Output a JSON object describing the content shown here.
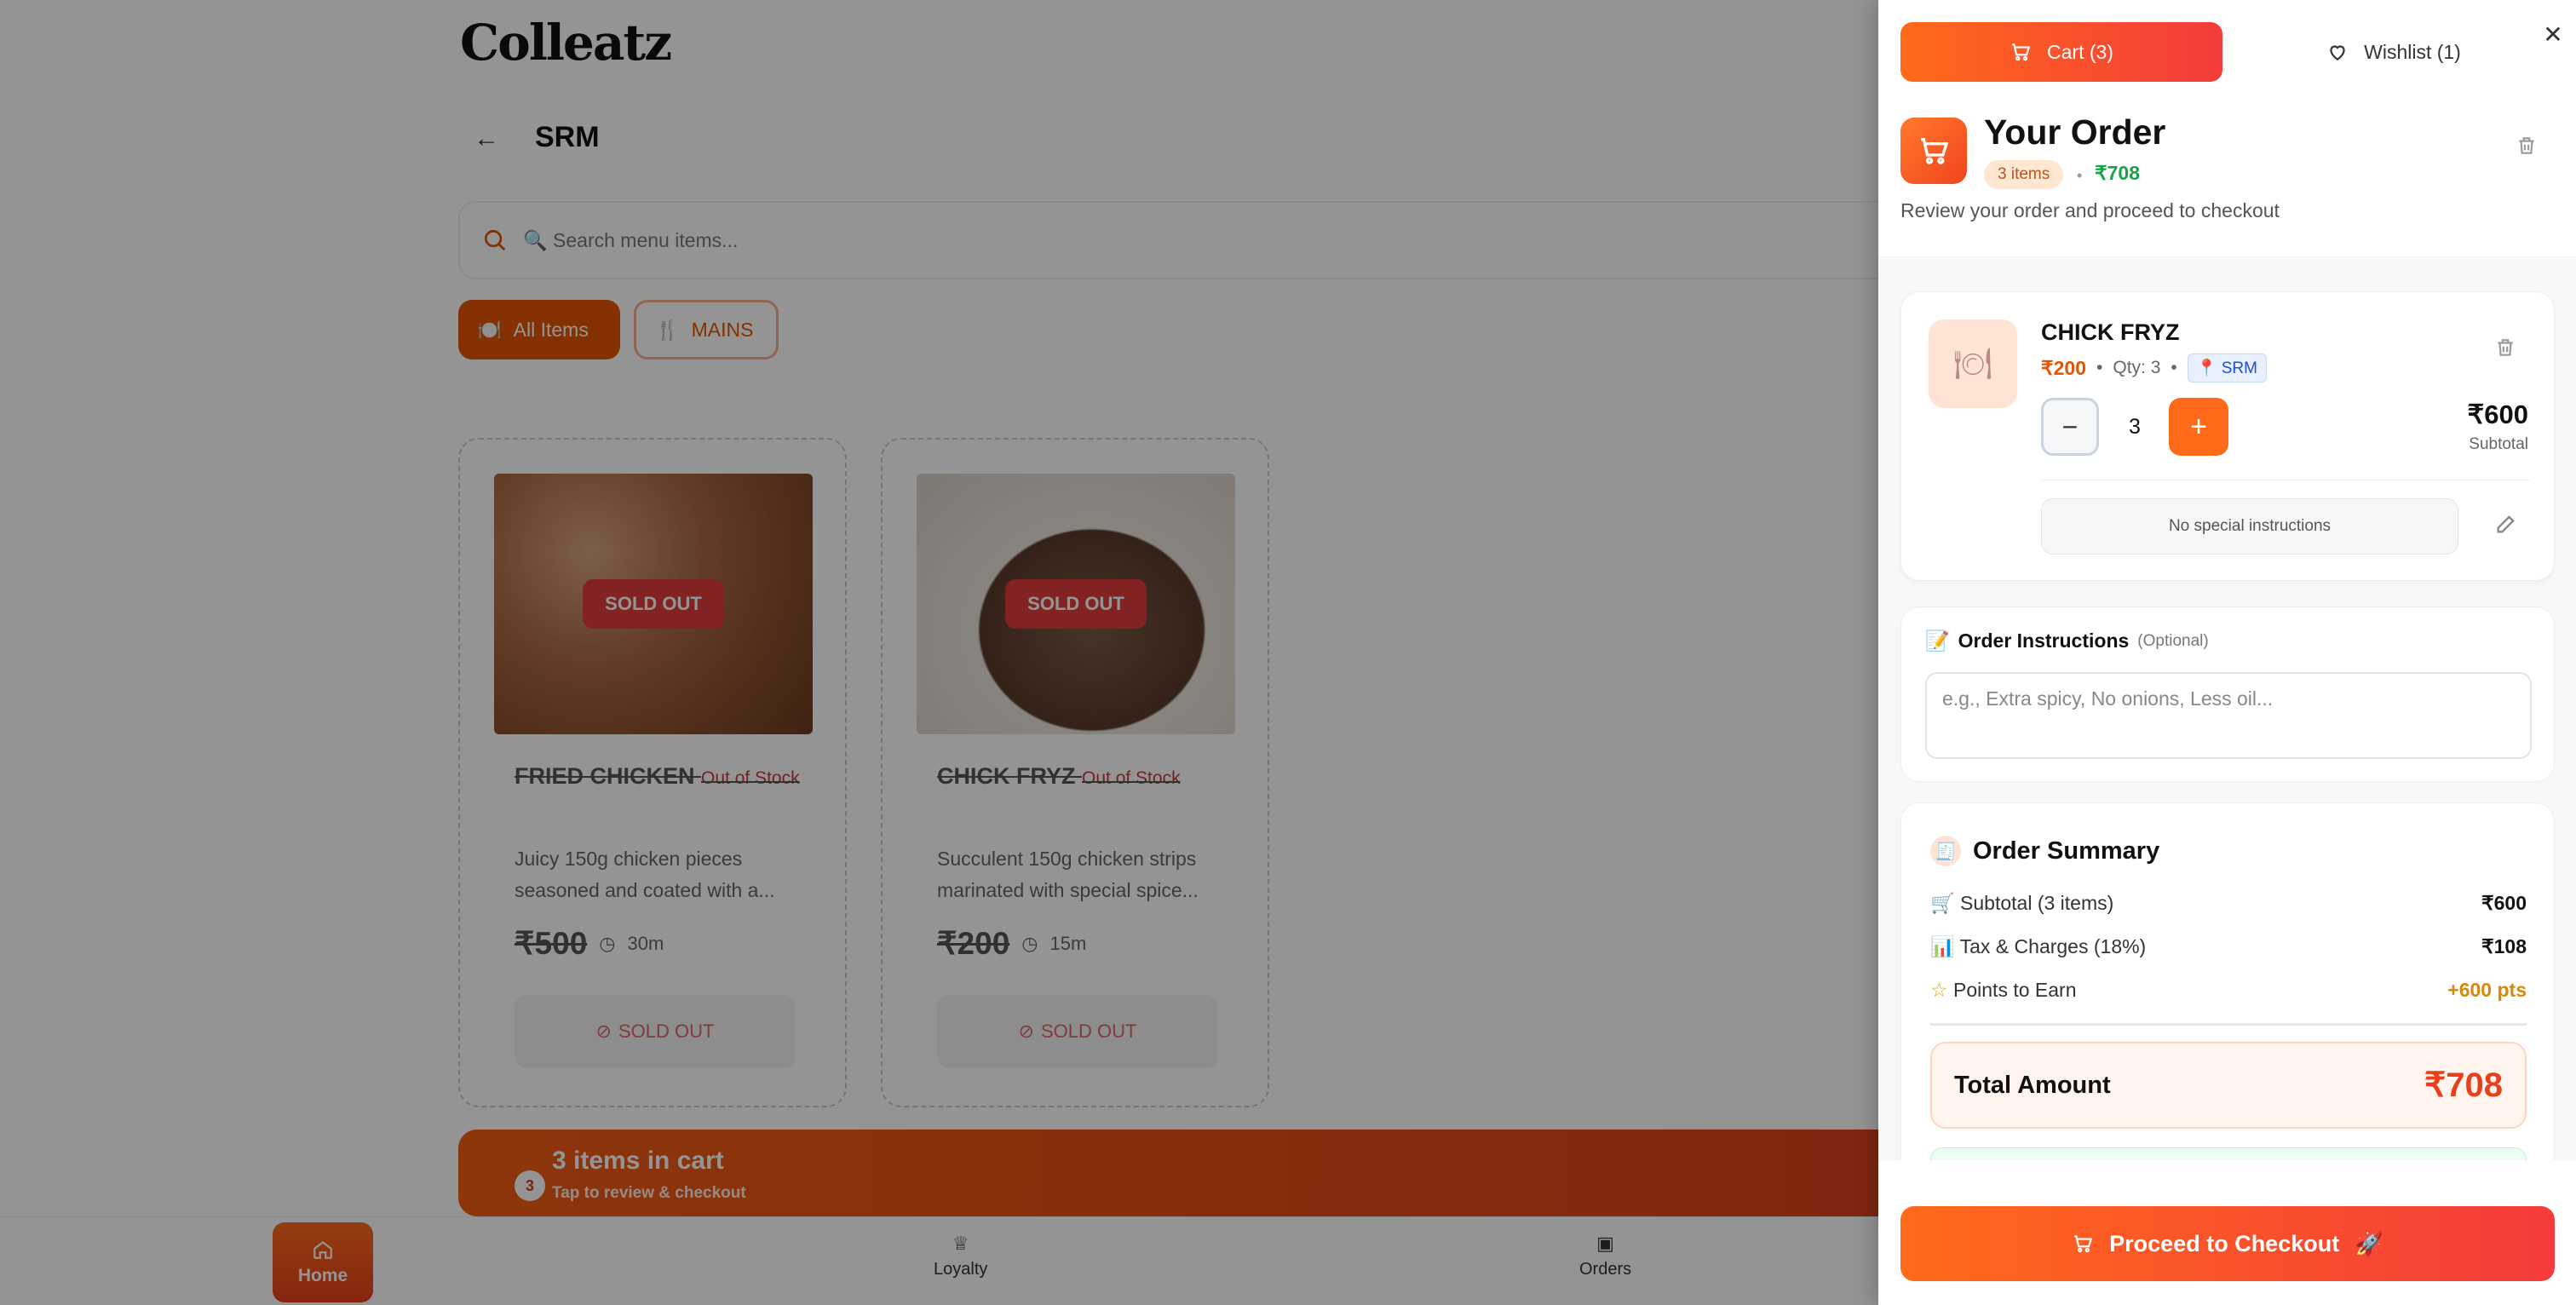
{
  "app": {
    "brand": "Colleatz"
  },
  "header": {
    "location": "SRM"
  },
  "search": {
    "placeholder": "🔍 Search menu items..."
  },
  "filters": [
    {
      "label": "All Items",
      "active": true
    },
    {
      "label": "MAINS",
      "active": false
    }
  ],
  "menu_items": [
    {
      "name": "FRIED CHICKEN",
      "stock": "Out of Stock",
      "badge": "SOLD OUT",
      "description": "Juicy 150g chicken pieces seasoned and coated with a...",
      "price": "₹500",
      "time": "30m",
      "button": "SOLD OUT"
    },
    {
      "name": "CHICK FRYZ",
      "stock": "Out of Stock",
      "badge": "SOLD OUT",
      "description": "Succulent 150g chicken strips marinated with special spice...",
      "price": "₹200",
      "time": "15m",
      "button": "SOLD OUT"
    }
  ],
  "cart_bar": {
    "title": "3 items in cart",
    "subtitle": "Tap to review & checkout",
    "count": "3"
  },
  "bottom_nav": [
    {
      "label": "Home"
    },
    {
      "label": "Loyalty"
    },
    {
      "label": "Orders"
    }
  ],
  "panel": {
    "tab_cart": "Cart (3)",
    "tab_wishlist": "Wishlist (1)",
    "title": "Your Order",
    "items_badge": "3 items",
    "total_small": "₹708",
    "subtitle": "Review your order and proceed to checkout",
    "item": {
      "name": "CHICK FRYZ",
      "price": "₹200",
      "qty_text": "Qty: 3",
      "location": "SRM",
      "qty": "3",
      "subtotal": "₹600",
      "subtotal_label": "Subtotal",
      "instructions": "No special instructions"
    },
    "order_instructions": {
      "label": "Order Instructions",
      "optional": "(Optional)",
      "placeholder": "e.g., Extra spicy, No onions, Less oil..."
    },
    "summary": {
      "title": "Order Summary",
      "rows": [
        {
          "label": "Subtotal (3 items)",
          "value": "₹600"
        },
        {
          "label": "Tax & Charges (18%)",
          "value": "₹108"
        },
        {
          "label": "Points to Earn",
          "value": "+600 pts"
        }
      ],
      "total_label": "Total Amount",
      "total_value": "₹708"
    },
    "checkout": "Proceed to Checkout"
  },
  "colors": {
    "accent": "#ff6a1a",
    "accent_end": "#f43b3b",
    "success": "#16a34a"
  }
}
